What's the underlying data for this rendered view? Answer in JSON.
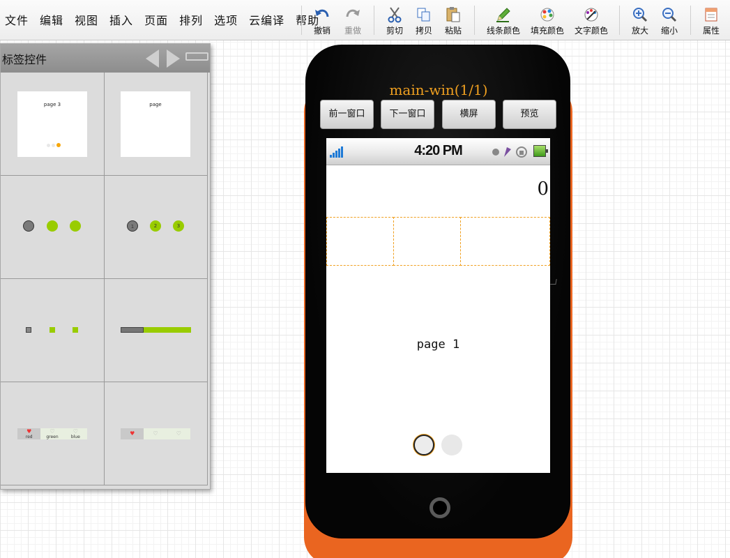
{
  "menu": [
    "文件",
    "编辑",
    "视图",
    "插入",
    "页面",
    "排列",
    "选项",
    "云编译",
    "帮助"
  ],
  "toolbar": {
    "undo": "撤销",
    "redo": "重做",
    "cut": "剪切",
    "copy": "拷贝",
    "paste": "粘贴",
    "line_color": "线条颜色",
    "fill_color": "填充颜色",
    "text_color": "文字颜色",
    "zoom_in": "放大",
    "zoom_out": "缩小",
    "properties": "属性"
  },
  "panel": {
    "title": "标签控件",
    "thumbs": {
      "page3": "page 3",
      "page": "page",
      "numbered_dots": [
        "1",
        "2",
        "3"
      ],
      "tabs_labeled": [
        "red",
        "green",
        "blue"
      ]
    }
  },
  "phone": {
    "title": "main-win(1/1)",
    "buttons": {
      "prev": "前一窗口",
      "next": "下一窗口",
      "landscape": "横屏",
      "preview": "预览"
    },
    "status_time": "4:20 PM",
    "counter": "0",
    "page_label": "page 1",
    "page_dots": {
      "count": 2,
      "active_index": 0
    }
  },
  "colors": {
    "accent": "#f0a020",
    "phone_case": "#ea6520",
    "indicator_green": "#99cc00"
  }
}
